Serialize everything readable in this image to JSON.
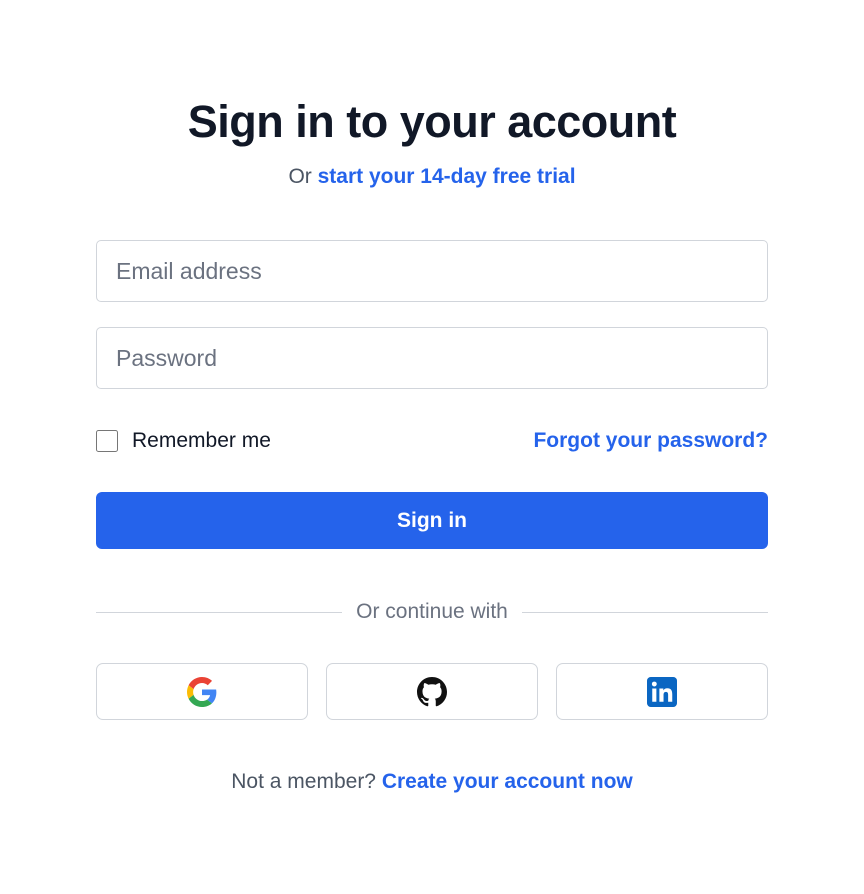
{
  "header": {
    "title": "Sign in to your account",
    "subtitle_prefix": "Or",
    "trial_link": "start your 14-day free trial"
  },
  "form": {
    "email": {
      "placeholder": "Email address",
      "value": ""
    },
    "password": {
      "placeholder": "Password",
      "value": ""
    },
    "remember_label": "Remember me",
    "remember_checked": false,
    "forgot_link": "Forgot your password?",
    "submit_label": "Sign in"
  },
  "divider": {
    "text": "Or continue with"
  },
  "social": [
    {
      "name": "google",
      "icon": "google-icon"
    },
    {
      "name": "github",
      "icon": "github-icon"
    },
    {
      "name": "linkedin",
      "icon": "linkedin-icon"
    }
  ],
  "footer": {
    "prompt": "Not a member?",
    "link": "Create your account now"
  },
  "colors": {
    "primary": "#2563eb",
    "heading": "#111827",
    "muted": "#6b7280",
    "border": "#d1d5db",
    "linkedin": "#0a66c2"
  }
}
